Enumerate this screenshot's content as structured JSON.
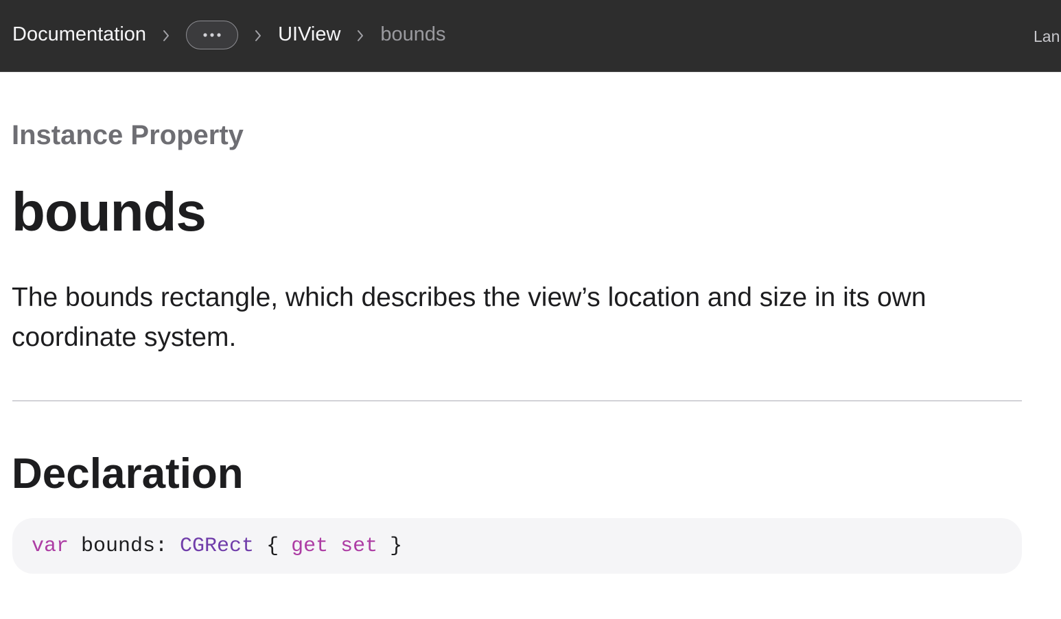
{
  "nav": {
    "breadcrumbs": [
      {
        "label": "Documentation"
      },
      {
        "label": "UIView"
      },
      {
        "label": "bounds"
      }
    ],
    "ellipsis_icon": "ellipsis-icon",
    "separator_icon": "chevron-right-icon",
    "language_label": "Lan"
  },
  "page": {
    "eyebrow": "Instance Property",
    "title": "bounds",
    "abstract": "The bounds rectangle, which describes the view’s location and size in its own coordinate system."
  },
  "declaration": {
    "heading": "Declaration",
    "tokens": {
      "kw_var": "var",
      "name": " bounds: ",
      "type": "CGRect",
      "open": " { ",
      "kw_get": "get",
      "space": " ",
      "kw_set": "set",
      "close": " }"
    }
  },
  "colors": {
    "topbar": "#2d2d2d",
    "keyword": "#ad3da4",
    "type": "#703daa",
    "code_bg": "#f5f5f7",
    "muted": "#6e6e73"
  }
}
